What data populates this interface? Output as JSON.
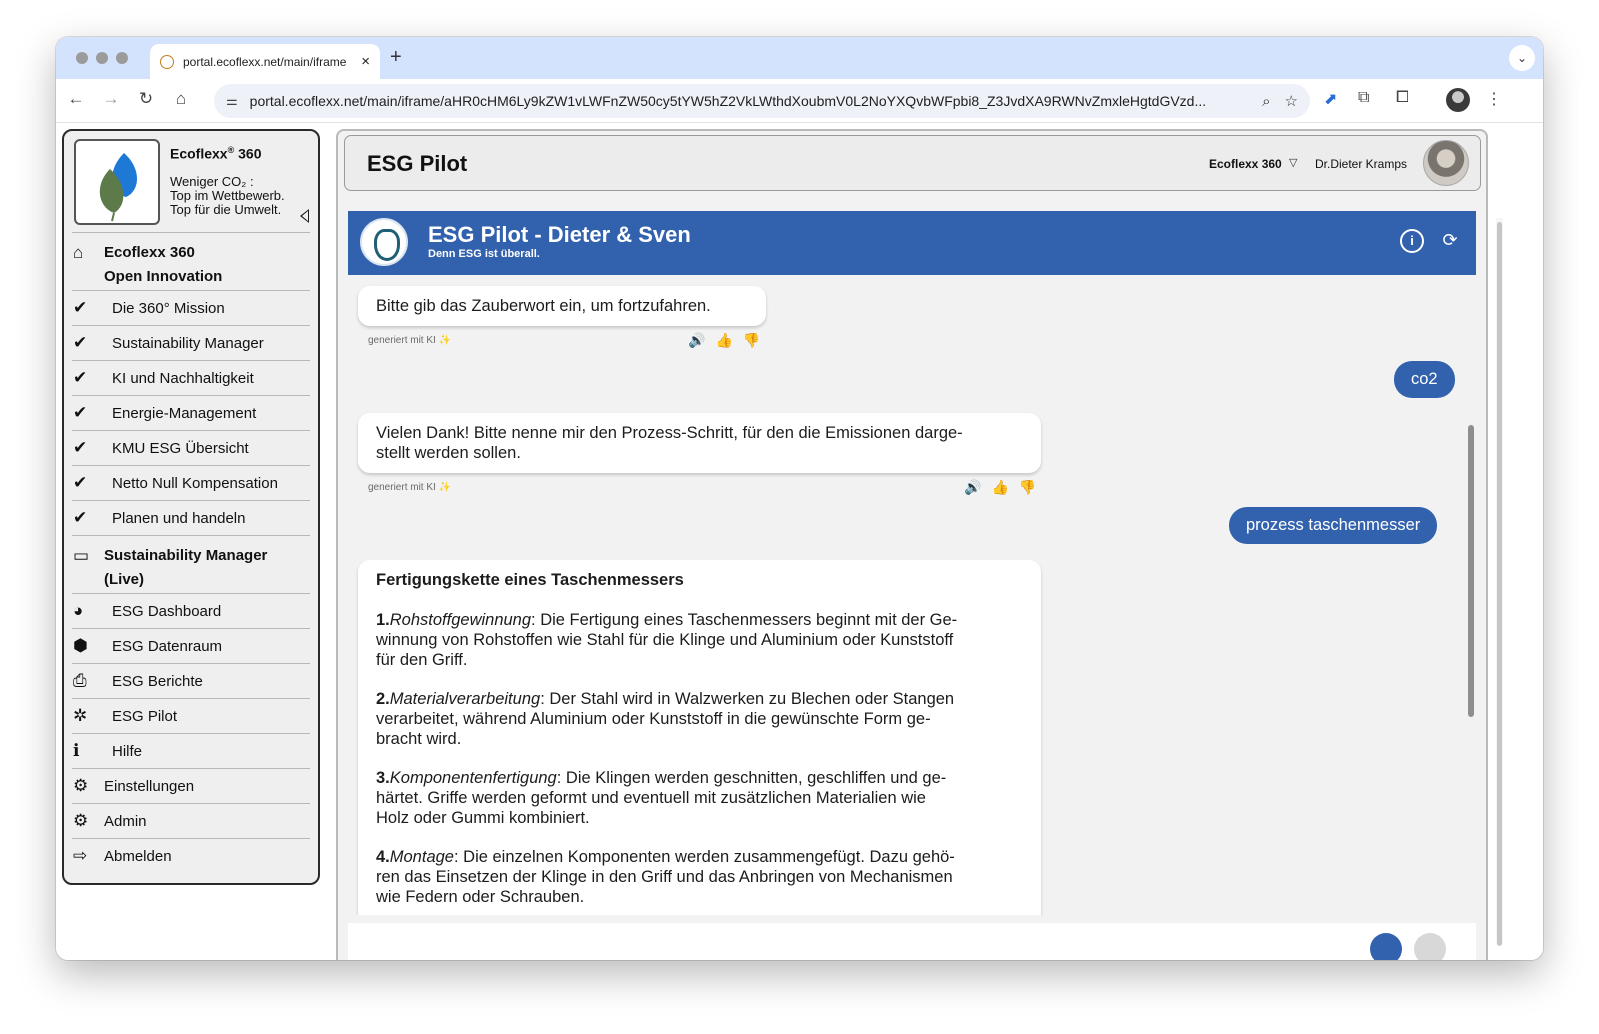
{
  "browser": {
    "tab_title": "portal.ecoflexx.net/main/iframe",
    "tab_close": "×",
    "new_tab": "+",
    "url": "portal.ecoflexx.net/main/iframe/aHR0cHM6Ly9kZW1vLWFnZW50cy5tYW5hZ2VkLWthdXoubmV0L2NoYXQvbWFpbi8_Z3JvdXA9RWNvZmxleHgtdGVzd..."
  },
  "brand": {
    "name": "Ecoflexx",
    "name_suffix": " 360",
    "registered": "®",
    "tagline": "Weniger CO₂ :\nTop im Wettbewerb.\nTop für die Umwelt."
  },
  "menu": [
    {
      "label": "Ecoflexx 360\nOpen Innovation",
      "icon": "home-icon",
      "glyph": "⌂"
    },
    {
      "label": "Die 360° Mission",
      "icon": "check-icon",
      "glyph": "✔"
    },
    {
      "label": "Sustainability Manager",
      "icon": "check-icon",
      "glyph": "✔"
    },
    {
      "label": "KI und Nachhaltigkeit",
      "icon": "check-icon",
      "glyph": "✔"
    },
    {
      "label": "Energie-Management",
      "icon": "check-icon",
      "glyph": "✔"
    },
    {
      "label": "KMU ESG Übersicht",
      "icon": "check-icon",
      "glyph": "✔"
    },
    {
      "label": "Netto Null Kompensation",
      "icon": "check-icon",
      "glyph": "✔"
    },
    {
      "label": "Planen und handeln",
      "icon": "check-icon",
      "glyph": "✔"
    },
    {
      "label": "Sustainability Manager\n(Live)",
      "icon": "folder-icon",
      "glyph": "▭"
    },
    {
      "label": "ESG Dashboard",
      "icon": "pie-chart-icon",
      "glyph": "◕"
    },
    {
      "label": "ESG Datenraum",
      "icon": "cube-icon",
      "glyph": "⬢"
    },
    {
      "label": "ESG Berichte",
      "icon": "pdf-file-icon",
      "glyph": "⎙"
    },
    {
      "label": "ESG Pilot",
      "icon": "ai-icon",
      "glyph": "✲"
    },
    {
      "label": "Hilfe",
      "icon": "info-icon",
      "glyph": "ℹ"
    },
    {
      "label": "Einstellungen",
      "icon": "gears-icon",
      "glyph": "⚙"
    },
    {
      "label": "Admin",
      "icon": "gears-icon",
      "glyph": "⚙"
    },
    {
      "label": "Abmelden",
      "icon": "logout-icon",
      "glyph": "⇨"
    }
  ],
  "header": {
    "page_title": "ESG Pilot",
    "product_select": "Ecoflexx 360",
    "product_caret": "▽",
    "user_name": "Dr.Dieter Kramps"
  },
  "chat": {
    "title": "ESG Pilot - Dieter & Sven",
    "subtitle": "Denn ESG ist überall.",
    "info_glyph": "i",
    "reload_glyph": "⟳",
    "messages": [
      {
        "role": "bot",
        "text": "Bitte gib das Zauberwort ein, um fortzufahren.",
        "meta": "generiert mit KI ✨"
      },
      {
        "role": "user",
        "text": "co2"
      },
      {
        "role": "bot",
        "text": "Vielen Dank! Bitte nenne mir den Prozess-Schritt, für den die Emissionen darge-\nstellt werden sollen.",
        "meta": "generiert mit KI ✨"
      },
      {
        "role": "user",
        "text": "prozess taschenmesser"
      }
    ],
    "answer": {
      "heading": "Fertigungskette eines Taschenmessers",
      "steps": [
        {
          "num": "1.",
          "term": "Rohstoffgewinnung",
          "text": ": Die Fertigung eines Taschenmessers beginnt mit der Ge-\nwinnung von Rohstoffen wie Stahl für die Klinge und Aluminium oder Kunststoff\nfür den Griff."
        },
        {
          "num": "2.",
          "term": "Materialverarbeitung",
          "text": ": Der Stahl wird in Walzwerken zu Blechen oder Stangen\nverarbeitet, während Aluminium oder Kunststoff in die gewünschte Form ge-\nbracht wird."
        },
        {
          "num": "3.",
          "term": "Komponentenfertigung",
          "text": ": Die Klingen werden geschnitten, geschliffen und ge-\nhärtet. Griffe werden geformt und eventuell mit zusätzlichen Materialien wie\nHolz oder Gummi kombiniert."
        },
        {
          "num": "4.",
          "term": "Montage",
          "text": ": Die einzelnen Komponenten werden zusammengefügt. Dazu gehö-\nren das Einsetzen der Klinge in den Griff und das Anbringen von Mechanismen\nwie Federn oder Schrauben."
        }
      ]
    },
    "actions": {
      "speak": "🔊",
      "like": "👍",
      "dislike": "👎"
    }
  },
  "colors": {
    "accent": "#3261ae",
    "tab_strip": "#d3e3fd",
    "sidebar_bg": "#efefef"
  }
}
